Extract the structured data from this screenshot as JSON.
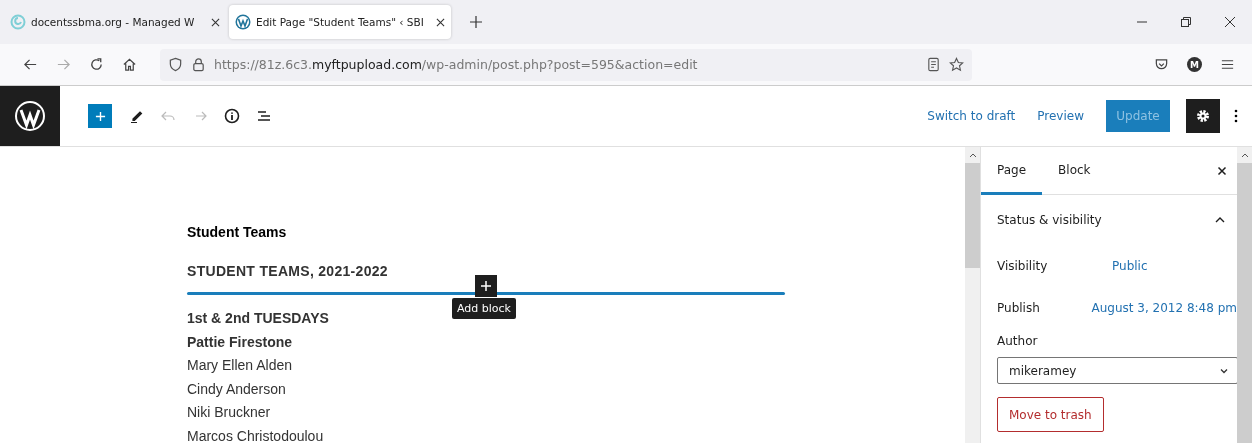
{
  "browser": {
    "tabs": [
      {
        "title": "docentssbma.org - Managed W",
        "selected": false
      },
      {
        "title": "Edit Page \"Student Teams\" ‹ SBI",
        "selected": true
      }
    ],
    "url": {
      "host_prefix": "https://81z.6c3.",
      "domain": "myftpupload.com",
      "path": "/wp-admin/post.php?post=595&action=edit"
    },
    "account_initial": "M"
  },
  "toolbar": {
    "actions": [
      "Switch to draft",
      "Preview"
    ],
    "primary": "Update"
  },
  "editor": {
    "blocks": [
      {
        "kind": "title",
        "text": "Student Teams"
      },
      {
        "kind": "heading",
        "text": "STUDENT TEAMS, 2021-2022"
      },
      {
        "kind": "separator",
        "tooltip": "Add block"
      },
      {
        "kind": "bold",
        "text": "1st & 2nd TUESDAYS"
      },
      {
        "kind": "bold",
        "text": "Pattie Firestone"
      },
      {
        "kind": "plain",
        "text": "Mary Ellen Alden"
      },
      {
        "kind": "plain",
        "text": "Cindy Anderson"
      },
      {
        "kind": "plain",
        "text": "Niki Bruckner"
      },
      {
        "kind": "plain",
        "text": "Marcos Christodoulou"
      }
    ]
  },
  "sidebar": {
    "tabs": [
      {
        "label": "Page",
        "selected": true
      },
      {
        "label": "Block",
        "selected": false
      }
    ],
    "panel": {
      "title": "Status & visibility",
      "expanded": true,
      "rows": [
        {
          "label": "Visibility",
          "value": "Public"
        },
        {
          "label": "Publish",
          "value": "August 3, 2012 8:48 pm"
        }
      ],
      "author_label": "Author",
      "author": "mikeramey",
      "trash": "Move to trash"
    }
  }
}
